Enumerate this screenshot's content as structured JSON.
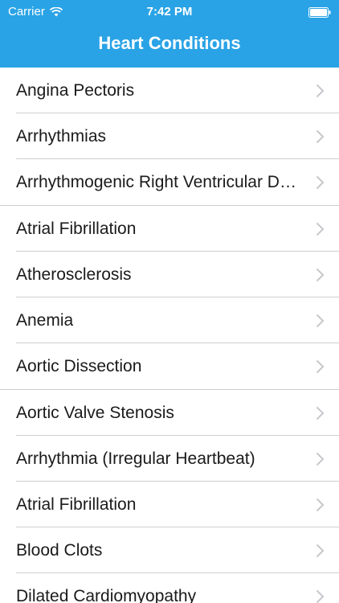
{
  "status_bar": {
    "carrier": "Carrier",
    "time": "7:42 PM"
  },
  "nav": {
    "title": "Heart Conditions"
  },
  "conditions": [
    "Angina Pectoris",
    "Arrhythmias",
    "Arrhythmogenic Right Ventricular Dysplasia",
    "Atrial Fibrillation",
    "Atherosclerosis",
    "Anemia",
    "Aortic Dissection",
    "Aortic Valve Stenosis",
    "Arrhythmia (Irregular Heartbeat)",
    "Atrial Fibrillation",
    "Blood Clots",
    "Dilated Cardiomyopathy"
  ],
  "colors": {
    "header": "#29a3e6",
    "separator": "#cfcfcf",
    "chevron": "#c7c7cc"
  }
}
